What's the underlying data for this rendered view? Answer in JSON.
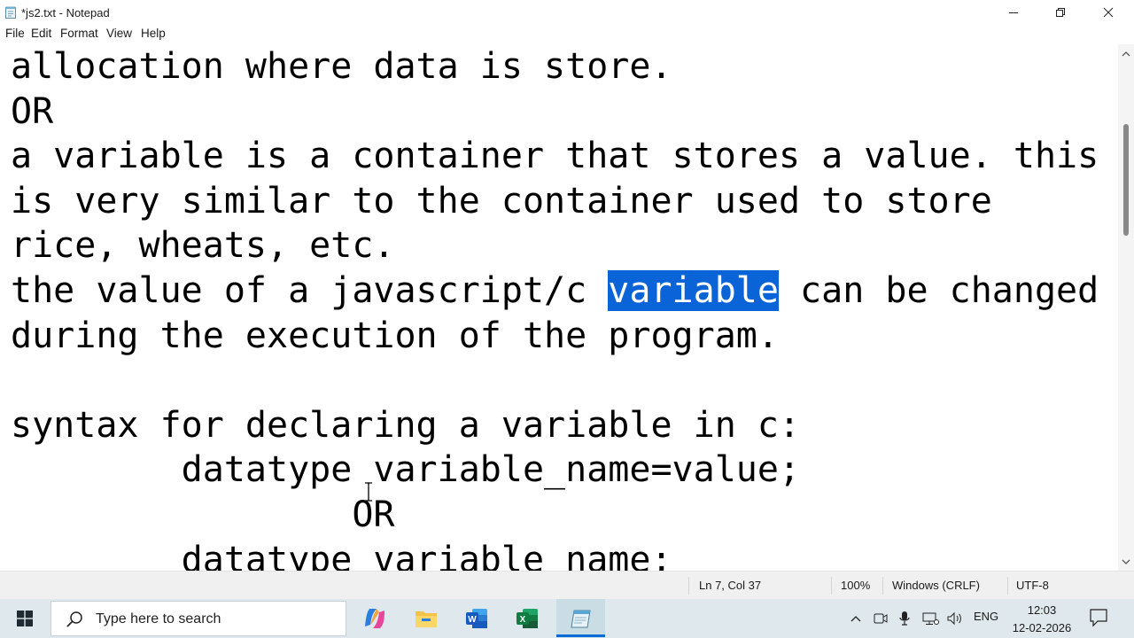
{
  "window": {
    "title": "*js2.txt - Notepad",
    "minimize_icon": "minimize-icon",
    "maximize_icon": "restore-icon",
    "close_icon": "close-icon"
  },
  "menu": [
    "File",
    "Edit",
    "Format",
    "View",
    "Help"
  ],
  "editor": {
    "lines": [
      {
        "text": "allocation where data is store."
      },
      {
        "text": "OR"
      },
      {
        "text": "a variable is a container that stores a value. this"
      },
      {
        "text": "is very similar to the container used to store"
      },
      {
        "text": "rice, wheats, etc."
      },
      {
        "before": "the value of a javascript/c ",
        "selected": "variable",
        "after": " can be changed"
      },
      {
        "text": "during the execution of the program."
      },
      {
        "text": ""
      },
      {
        "text": "syntax for declaring a variable in c:"
      },
      {
        "text": "        datatype variable_name=value;"
      },
      {
        "text": "                OR"
      },
      {
        "text": "        datatype variable_name;"
      }
    ],
    "selection_color": "#0b63d8"
  },
  "status": {
    "position": "Ln 7, Col 37",
    "zoom": "100%",
    "line_ending": "Windows (CRLF)",
    "encoding": "UTF-8"
  },
  "taskbar": {
    "search_placeholder": "Type here to search",
    "apps": [
      "copilot-icon",
      "file-explorer-icon",
      "word-icon",
      "excel-icon",
      "notepad-icon"
    ],
    "language": "ENG",
    "time": "12:03",
    "date": "12-02-2026"
  }
}
